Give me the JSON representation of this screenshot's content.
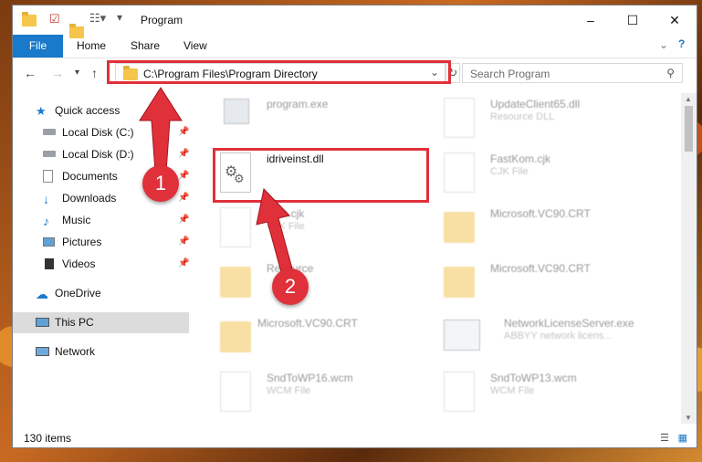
{
  "window": {
    "title": "Program"
  },
  "ribbon": {
    "tabs": [
      "File",
      "Home",
      "Share",
      "View"
    ]
  },
  "address": {
    "path": "C:\\Program Files\\Program Directory"
  },
  "search": {
    "placeholder": "Search Program"
  },
  "nav": {
    "items": [
      {
        "label": "Quick access",
        "icon": "star-icon"
      },
      {
        "label": "Local Disk (C:)",
        "icon": "drive-icon"
      },
      {
        "label": "Local Disk (D:)",
        "icon": "drive-icon"
      },
      {
        "label": "Documents",
        "icon": "documents-icon"
      },
      {
        "label": "Downloads",
        "icon": "download-icon"
      },
      {
        "label": "Music",
        "icon": "music-icon"
      },
      {
        "label": "Pictures",
        "icon": "pictures-icon"
      },
      {
        "label": "Videos",
        "icon": "videos-icon"
      },
      {
        "label": "OneDrive",
        "icon": "cloud-icon"
      },
      {
        "label": "This PC",
        "icon": "computer-icon"
      },
      {
        "label": "Network",
        "icon": "network-icon"
      }
    ]
  },
  "files": {
    "left": [
      {
        "name": "program.exe",
        "type": ""
      },
      {
        "name": "idriveinst.dll",
        "type": ""
      },
      {
        "name": "...en.cjk",
        "type": "CJK File"
      },
      {
        "name": "Resource",
        "type": ""
      },
      {
        "name": "Microsoft.VC90.CRT",
        "type": ""
      },
      {
        "name": "SndToWP16.wcm",
        "type": "WCM File"
      }
    ],
    "right": [
      {
        "name": "UpdateClient65.dll",
        "type": "Resource DLL"
      },
      {
        "name": "FastKom.cjk",
        "type": "CJK File"
      },
      {
        "name": "Microsoft.VC90.CRT",
        "type": ""
      },
      {
        "name": "Microsoft.VC90.CRT",
        "type": ""
      },
      {
        "name": "NetworkLicenseServer.exe",
        "type": "ABBYY network licens..."
      },
      {
        "name": "SndToWP13.wcm",
        "type": "WCM File"
      }
    ]
  },
  "status": {
    "count": "130 items"
  },
  "annotations": {
    "step1": "1",
    "step2": "2"
  },
  "colors": {
    "accent": "#1979ca",
    "highlight": "#e0303a"
  }
}
